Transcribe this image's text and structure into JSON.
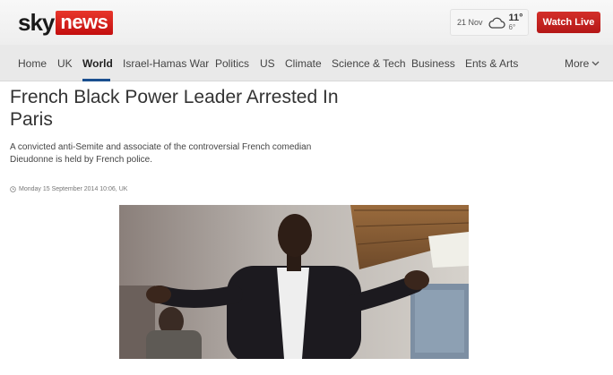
{
  "brand": {
    "sky": "sky",
    "news": "news"
  },
  "weather": {
    "date": "21 Nov",
    "high": "11°",
    "low": "6°",
    "icon": "cloud-icon"
  },
  "header": {
    "watch_live": "Watch Live"
  },
  "nav": {
    "items": [
      {
        "label": "Home"
      },
      {
        "label": "UK"
      },
      {
        "label": "World",
        "active": true
      },
      {
        "label": "Israel-Hamas War"
      },
      {
        "label": "Politics"
      },
      {
        "label": "US"
      },
      {
        "label": "Climate"
      },
      {
        "label": "Science & Tech"
      },
      {
        "label": "Business"
      },
      {
        "label": "Ents & Arts"
      }
    ],
    "more": "More"
  },
  "article": {
    "headline": "French Black Power Leader Arrested In Paris",
    "standfirst": "A convicted anti-Semite and associate of the controversial French comedian Dieudonne is held by French police.",
    "timestamp": "Monday 15 September 2014 10:06, UK"
  },
  "colors": {
    "brand_red": "#c8171b",
    "nav_active_underline": "#1a4f8f"
  }
}
